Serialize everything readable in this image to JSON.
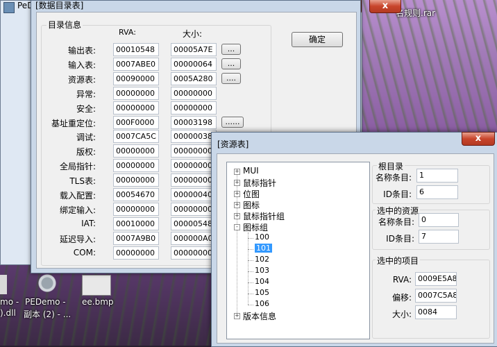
{
  "bg_window": {
    "title": "PeD"
  },
  "desktop": {
    "top_right_filename": "名规则.rar",
    "icons": [
      {
        "label_line1": "mo -",
        "label_line2": ").dll"
      },
      {
        "label_line1": "PEDemo -",
        "label_line2": "副本 (2) - ..."
      },
      {
        "label_line1": "ee.bmp",
        "label_line2": ""
      }
    ]
  },
  "dir_window": {
    "title": "[数据目录表]",
    "group_label": "目录信息",
    "col_rva": "RVA:",
    "col_size": "大小:",
    "ok_button": "确定",
    "rows": [
      {
        "label": "输出表:",
        "rva": "00010548",
        "size": "00005A7E",
        "button": "..."
      },
      {
        "label": "输入表:",
        "rva": "0007ABE0",
        "size": "00000064",
        "button": "..."
      },
      {
        "label": "资源表:",
        "rva": "00090000",
        "size": "0005A280",
        "button": "...."
      },
      {
        "label": "异常:",
        "rva": "00000000",
        "size": "00000000",
        "button": ""
      },
      {
        "label": "安全:",
        "rva": "00000000",
        "size": "00000000",
        "button": ""
      },
      {
        "label": "基址重定位:",
        "rva": "000F0000",
        "size": "00003198",
        "button": "......"
      },
      {
        "label": "调试:",
        "rva": "0007CA5C",
        "size": "00000038",
        "button": ""
      },
      {
        "label": "版权:",
        "rva": "00000000",
        "size": "00000000",
        "button": ""
      },
      {
        "label": "全局指针:",
        "rva": "00000000",
        "size": "00000000",
        "button": ""
      },
      {
        "label": "TLS表:",
        "rva": "00000000",
        "size": "00000000",
        "button": ""
      },
      {
        "label": "载入配置:",
        "rva": "00054670",
        "size": "00000040",
        "button": ""
      },
      {
        "label": "绑定输入:",
        "rva": "00000000",
        "size": "00000000",
        "button": ""
      },
      {
        "label": "IAT:",
        "rva": "00010000",
        "size": "00000548",
        "button": ""
      },
      {
        "label": "延迟导入:",
        "rva": "0007A9B0",
        "size": "000000A0",
        "button": ""
      },
      {
        "label": "COM:",
        "rva": "00000000",
        "size": "00000000",
        "button": ""
      }
    ]
  },
  "res_window": {
    "title": "[资源表]",
    "close_glyph": "x",
    "tree": {
      "top": [
        {
          "label": "MUI",
          "expander": "+"
        },
        {
          "label": "鼠标指针",
          "expander": "+"
        },
        {
          "label": "位图",
          "expander": "+"
        },
        {
          "label": "图标",
          "expander": "+"
        },
        {
          "label": "鼠标指针组",
          "expander": "+"
        },
        {
          "label": "图标组",
          "expander": "-"
        }
      ],
      "children": [
        "100",
        "101",
        "102",
        "103",
        "104",
        "105",
        "106"
      ],
      "selected_child": "101",
      "last": {
        "label": "版本信息",
        "expander": "+"
      }
    },
    "root_group": {
      "label": "根目录",
      "name_label": "名称条目:",
      "name_value": "1",
      "id_label": "ID条目:",
      "id_value": "6"
    },
    "selected_group": {
      "label": "选中的资源",
      "name_label": "名称条目:",
      "name_value": "0",
      "id_label": "ID条目:",
      "id_value": "7"
    },
    "item_group": {
      "label": "选中的项目",
      "rva_label": "RVA:",
      "rva_value": "0009E5A8",
      "offset_label": "偏移:",
      "offset_value": "0007C5A8",
      "size_label": "大小:",
      "size_value": "0084"
    }
  }
}
